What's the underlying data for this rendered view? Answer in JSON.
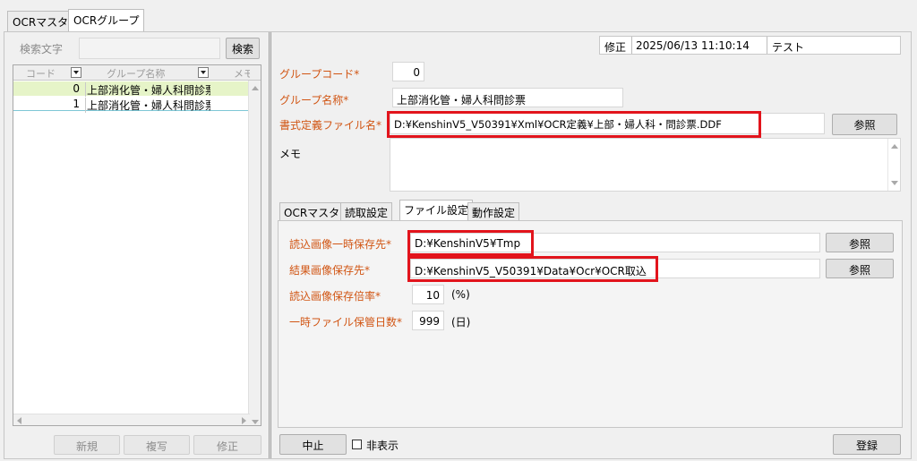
{
  "tabs": {
    "ocr_master": "OCRマスタ",
    "ocr_group": "OCRグループ"
  },
  "left": {
    "search_label": "検索文字",
    "search_value": "",
    "search_button": "検索",
    "grid": {
      "headers": {
        "code": "コード",
        "group_name": "グループ名称",
        "memo": "メモ"
      },
      "rows": [
        {
          "code": "0",
          "name": "上部消化管・婦人科問診票"
        },
        {
          "code": "1",
          "name": "上部消化管・婦人科問診票"
        }
      ]
    },
    "buttons": {
      "new": "新規",
      "copy": "複写",
      "edit": "修正"
    }
  },
  "header": {
    "status": "修正",
    "datetime": "2025/06/13 11:10:14",
    "user": "テスト"
  },
  "form": {
    "group_code_label": "グループコード*",
    "group_code_value": "0",
    "group_name_label": "グループ名称*",
    "group_name_value": "上部消化管・婦人科問診票",
    "format_file_label": "書式定義ファイル名*",
    "format_file_value": "D:¥KenshinV5_V50391¥Xml¥OCR定義¥上部・婦人科・問診票.DDF",
    "browse_label": "参照",
    "memo_label": "メモ",
    "memo_value": ""
  },
  "subtabs": {
    "ocr_master": "OCRマスタ",
    "read_settings": "読取設定",
    "file_settings": "ファイル設定",
    "action_settings": "動作設定"
  },
  "file_settings": {
    "temp_dir_label": "読込画像一時保存先*",
    "temp_dir_value": "D:¥KenshinV5¥Tmp",
    "result_dir_label": "結果画像保存先*",
    "result_dir_value": "D:¥KenshinV5_V50391¥Data¥Ocr¥OCR取込",
    "ratio_label": "読込画像保存倍率*",
    "ratio_value": "10",
    "ratio_unit": "(%)",
    "days_label": "一時ファイル保管日数*",
    "days_value": "999",
    "days_unit": "(日)",
    "browse_label": "参照"
  },
  "footer": {
    "cancel": "中止",
    "hide_label": "非表示",
    "hide_checked": false,
    "register": "登録"
  },
  "colors": {
    "required_label": "#d15513",
    "highlight": "#e2141c",
    "selected_row": "#e6f4c8"
  }
}
